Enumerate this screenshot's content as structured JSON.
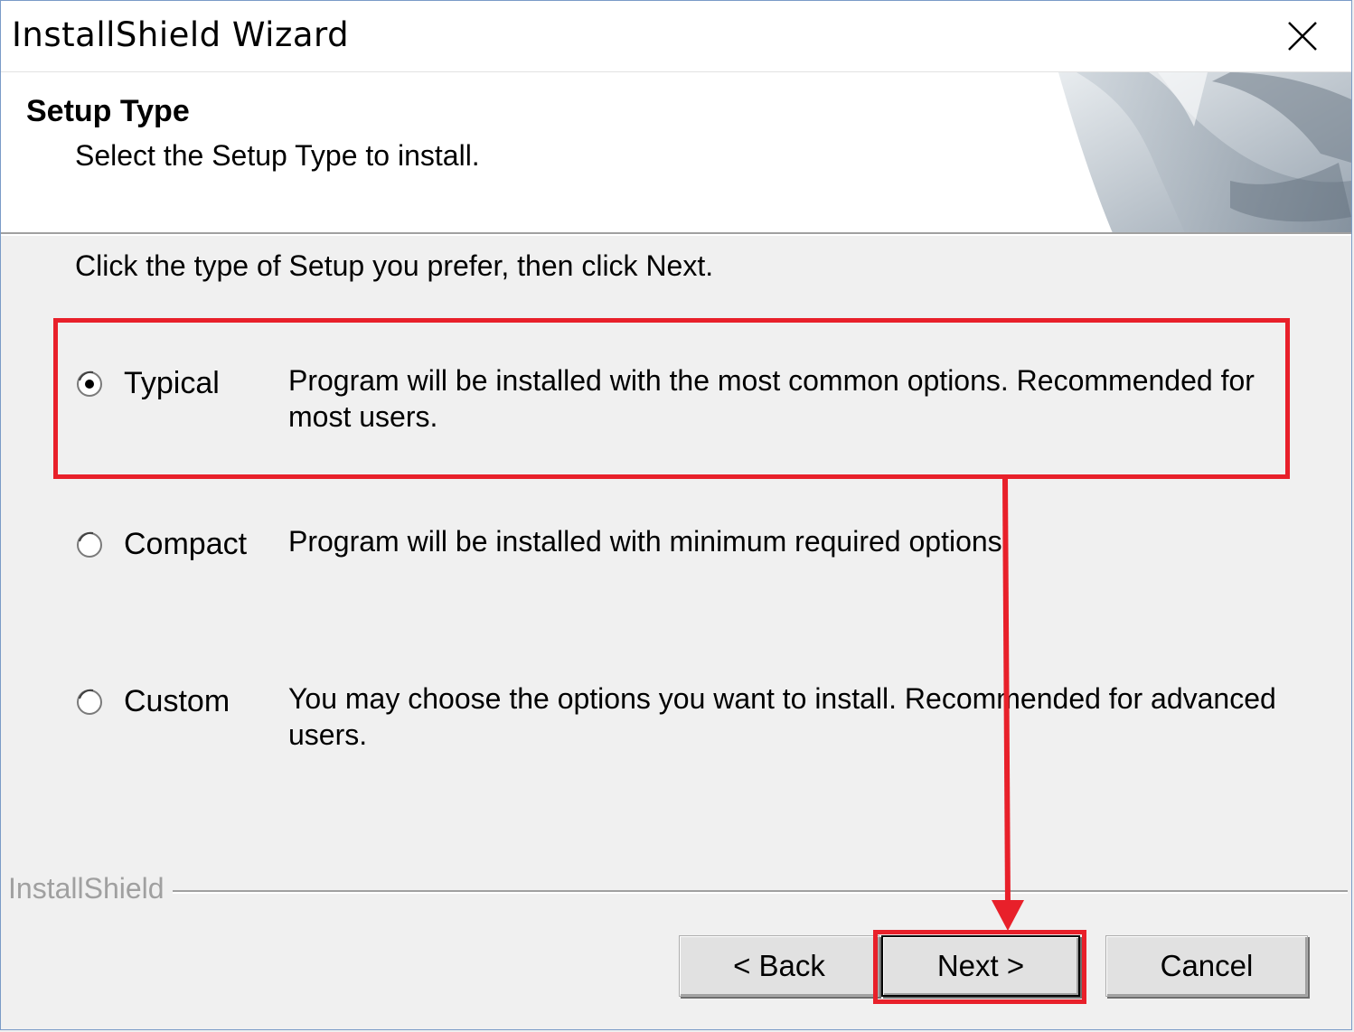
{
  "window": {
    "title": "InstallShield Wizard"
  },
  "header": {
    "title": "Setup Type",
    "subtitle": "Select the Setup Type to install."
  },
  "main": {
    "instruction": "Click the type of Setup you prefer, then click Next.",
    "options": [
      {
        "label": "Typical",
        "description": "Program will be installed with the most common options.  Recommended for most users.",
        "selected": true
      },
      {
        "label": "Compact",
        "description": "Program will be installed with minimum required options.",
        "selected": false
      },
      {
        "label": "Custom",
        "description": "You may choose the options you want to install. Recommended for advanced users.",
        "selected": false
      }
    ]
  },
  "footer": {
    "brand": "InstallShield",
    "back_label": "< Back",
    "next_label": "Next >",
    "cancel_label": "Cancel"
  },
  "annotation": {
    "highlight_color": "#e8202a"
  },
  "icons": {
    "close": "close-icon",
    "radio": "radio-button-icon",
    "header_art": "page-curl-art"
  }
}
